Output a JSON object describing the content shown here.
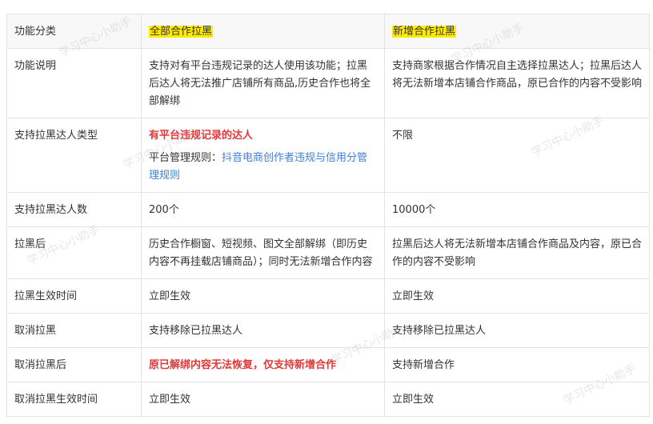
{
  "table": {
    "header": {
      "label": "功能分类",
      "col_a": "全部合作拉黑",
      "col_b": "新增合作拉黑"
    },
    "rows": [
      {
        "label": "功能说明",
        "a": "支持对有平台违规记录的达人使用该功能；拉黑后达人将无法推广店铺所有商品,历史合作也将全部解绑",
        "b": "支持商家根据合作情况自主选择拉黑达人；拉黑后达人将无法新增本店铺合作商品，原已合作的内容不受影响"
      },
      {
        "label": "支持拉黑达人类型",
        "a_strong": "有平台违规记录的达人",
        "a_prefix": "平台管理规则：",
        "a_link": "抖音电商创作者违规与信用分管理规则",
        "b": "不限"
      },
      {
        "label": "支持拉黑达人数",
        "a": "200个",
        "b": "10000个"
      },
      {
        "label": "拉黑后",
        "a": "历史合作橱窗、短视频、图文全部解绑（即历史内容不再挂载店铺商品）；同时无法新增合作内容",
        "b": "拉黑后达人将无法新增本店铺合作商品及内容，原已合作的内容不受影响"
      },
      {
        "label": "拉黑生效时间",
        "a": "立即生效",
        "b": "立即生效"
      },
      {
        "label": "取消拉黑",
        "a": "支持移除已拉黑达人",
        "b": "支持移除已拉黑达人"
      },
      {
        "label": "取消拉黑后",
        "a_strong": "原已解绑内容无法恢复，仅支持新增合作",
        "b": "支持新增合作"
      },
      {
        "label": "取消拉黑生效时间",
        "a": "立即生效",
        "b": "立即生效"
      }
    ]
  },
  "watermark": "学习中心小助手",
  "colors": {
    "highlight": "#ffea00",
    "emphasis_red": "#e23838",
    "link_blue": "#3f7fd8",
    "border": "#e3e3e3"
  }
}
